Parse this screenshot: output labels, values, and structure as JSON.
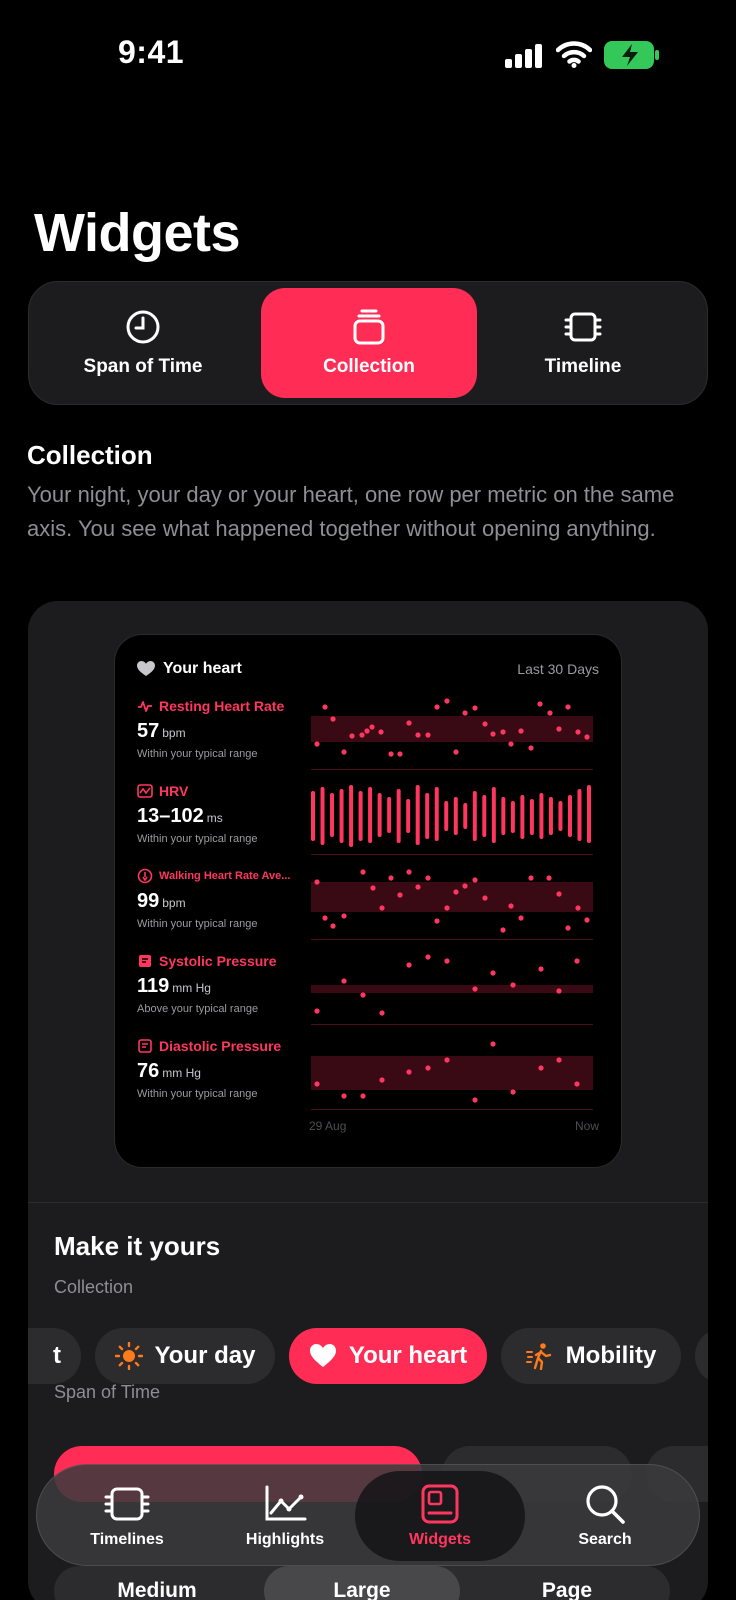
{
  "status_bar": {
    "time": "9:41"
  },
  "title": "Widgets",
  "segments": [
    {
      "label": "Span of Time",
      "icon": "clock-icon"
    },
    {
      "label": "Collection",
      "icon": "stack-icon",
      "active": true
    },
    {
      "label": "Timeline",
      "icon": "timeline-icon"
    }
  ],
  "section": {
    "heading": "Collection",
    "description": "Your night, your day or your heart, one row per metric on the same axis. You see what happened together without opening anything."
  },
  "widget": {
    "title": "Your heart",
    "range": "Last 30 Days",
    "x_start": "29 Aug",
    "x_end": "Now",
    "metrics": [
      {
        "name": "Resting Heart Rate",
        "value": "57",
        "unit": "bpm",
        "status": "Within your typical range",
        "chart": "dots"
      },
      {
        "name": "HRV",
        "value": "13–102",
        "unit": "ms",
        "status": "Within your typical range",
        "chart": "bars"
      },
      {
        "name": "Walking Heart Rate Ave...",
        "value": "99",
        "unit": "bpm",
        "status": "Within your typical range",
        "chart": "dots"
      },
      {
        "name": "Systolic Pressure",
        "value": "119",
        "unit": "mm Hg",
        "status": "Above your typical range",
        "chart": "dots"
      },
      {
        "name": "Diastolic Pressure",
        "value": "76",
        "unit": "mm Hg",
        "status": "Within your typical range",
        "chart": "dots"
      }
    ]
  },
  "customize": {
    "title": "Make it yours",
    "collection_label": "Collection",
    "collection_chips": [
      {
        "label": "t",
        "icon": ""
      },
      {
        "label": "Your day",
        "icon": "sun-icon"
      },
      {
        "label": "Your heart",
        "icon": "heart-icon",
        "active": true
      },
      {
        "label": "Mobility",
        "icon": "walking-icon"
      }
    ],
    "span_label": "Span of Time",
    "sizes": [
      {
        "label": "Medium"
      },
      {
        "label": "Large",
        "active": true
      },
      {
        "label": "Page"
      }
    ]
  },
  "tab_bar": [
    {
      "label": "Timelines",
      "icon": "timelines-icon"
    },
    {
      "label": "Highlights",
      "icon": "highlights-icon"
    },
    {
      "label": "Widgets",
      "icon": "widgets-icon",
      "active": true
    },
    {
      "label": "Search",
      "icon": "search-icon"
    }
  ],
  "colors": {
    "accent": "#ff2d55",
    "accent_text": "#ff375f",
    "band": "#3a0a14"
  }
}
